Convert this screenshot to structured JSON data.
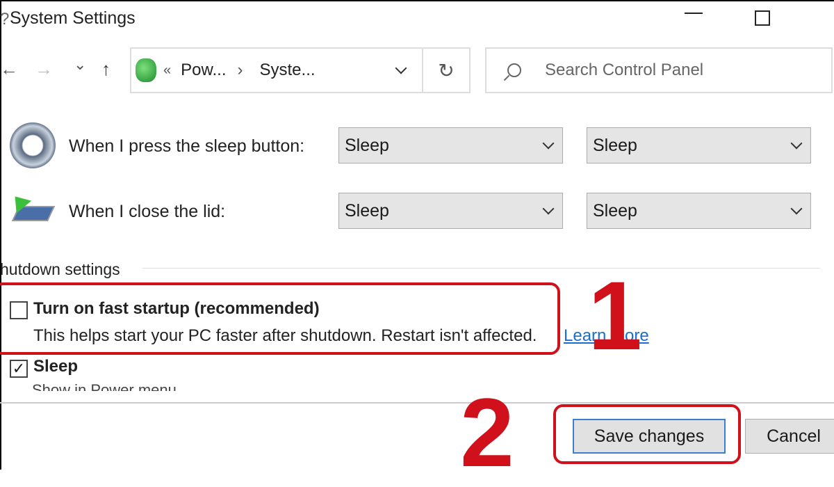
{
  "window": {
    "title": "System Settings",
    "maximize_icon": "square-icon"
  },
  "nav": {
    "back": "←",
    "forward": "→",
    "recent": "⌄",
    "up": "↑"
  },
  "address": {
    "prefix": "«",
    "crumbs": [
      "Pow...",
      "Syste..."
    ],
    "separator": "›",
    "refresh": "↻"
  },
  "search": {
    "placeholder": "Search Control Panel"
  },
  "rows": [
    {
      "label": "When I press the sleep button:",
      "battery": "Sleep",
      "plugged": "Sleep",
      "icon": "sleep-button-icon"
    },
    {
      "label": "When I close the lid:",
      "battery": "Sleep",
      "plugged": "Sleep",
      "icon": "laptop-lid-icon"
    }
  ],
  "shutdown": {
    "heading": "hutdown settings",
    "fast_startup": {
      "label": "Turn on fast startup (recommended)",
      "checked": false,
      "description": "This helps start your PC faster after shutdown. Restart isn't affected.",
      "link": "Learn more"
    },
    "sleep": {
      "label": "Sleep",
      "checked": true,
      "description": "Show in Power menu"
    }
  },
  "buttons": {
    "save": "Save changes",
    "cancel": "Cancel"
  },
  "annotations": {
    "step1": "1",
    "step2": "2",
    "color": "#d0101a"
  }
}
